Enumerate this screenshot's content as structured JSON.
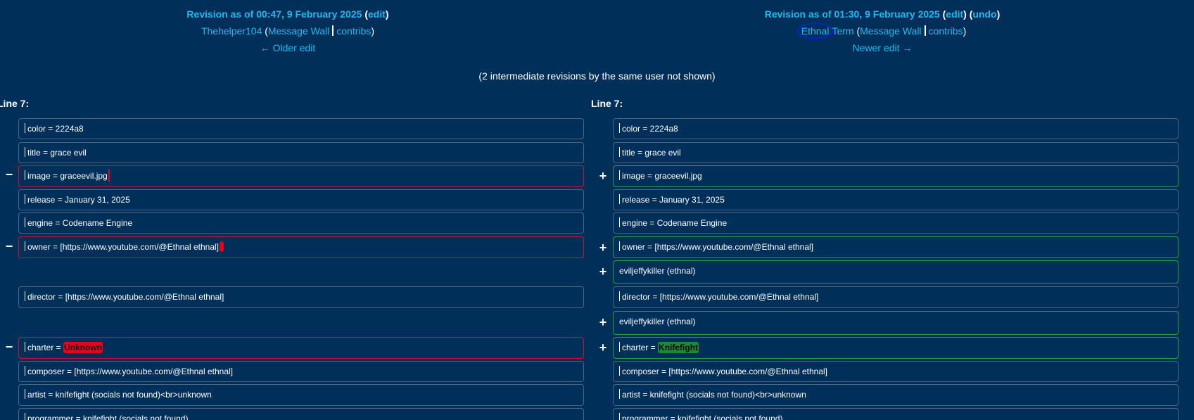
{
  "left": {
    "revision_title": "Revision as of 00:47, 9 February 2025",
    "edit_link": "edit",
    "user": "Thehelper104",
    "message_wall": "Message Wall",
    "contribs": "contribs",
    "nav_link": "← Older edit"
  },
  "right": {
    "revision_title": "Revision as of 01:30, 9 February 2025",
    "edit_link": "edit",
    "undo_link": "undo",
    "user_part1": "Ethnal",
    "user_part2": "Term",
    "message_wall": "Message Wall",
    "contribs": "contribs",
    "nav_link": "Newer edit →"
  },
  "middle_note": "(2 intermediate revisions by the same user not shown)",
  "line_label_left": "Line 7:",
  "line_label_right": "Line 7:",
  "markers": {
    "minus": "−",
    "plus": "+"
  },
  "diff": {
    "color": "color = 2224a8",
    "title": "title = grace evil",
    "image": "image = graceevil.jpg",
    "release": "release = January 31, 2025",
    "engine": "engine = Codename Engine",
    "owner": "owner = [https://www.youtube.com/@Ethnal ethnal]",
    "added_line": "eviljeffykiller (ethnal)",
    "director": "director = [https://www.youtube.com/@Ethnal ethnal]",
    "charter_prefix": "charter = ",
    "charter_old": "Unknown",
    "charter_new": "Knifefight",
    "composer": "composer = [https://www.youtube.com/@Ethnal ethnal]",
    "artist": "artist = knifefight (socials not found)<br>unknown",
    "programmer": "programmer = knifefight (socials not found)"
  }
}
